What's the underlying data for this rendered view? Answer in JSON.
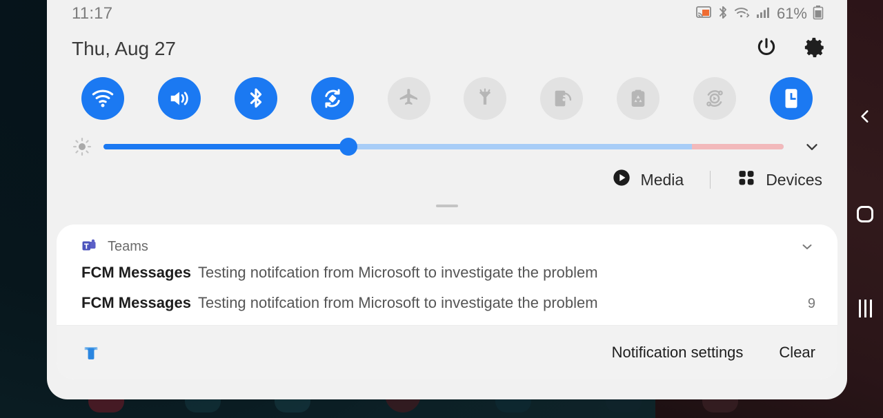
{
  "status_bar": {
    "clock": "11:17",
    "battery_percent": "61%",
    "icons": [
      "smart-view-cast-icon",
      "bluetooth-icon",
      "wifi-icon",
      "signal-icon",
      "battery-icon"
    ]
  },
  "header": {
    "date": "Thu, Aug 27",
    "power_label": "power-icon",
    "settings_label": "gear-icon"
  },
  "quick_settings": {
    "tiles": [
      {
        "name": "wifi",
        "icon": "wifi-icon",
        "active": true
      },
      {
        "name": "sound",
        "icon": "volume-icon",
        "active": true
      },
      {
        "name": "bluetooth",
        "icon": "bluetooth-icon",
        "active": true
      },
      {
        "name": "auto-rotate",
        "icon": "auto-rotate-icon",
        "active": true
      },
      {
        "name": "airplane-mode",
        "icon": "airplane-icon",
        "active": false
      },
      {
        "name": "flashlight",
        "icon": "flashlight-icon",
        "active": false
      },
      {
        "name": "mobile-data",
        "icon": "mobile-data-icon",
        "active": false
      },
      {
        "name": "power-saving",
        "icon": "power-saving-icon",
        "active": false
      },
      {
        "name": "smart-view",
        "icon": "smart-view-icon",
        "active": false
      },
      {
        "name": "blue-light-filter",
        "icon": "blue-light-filter-icon",
        "active": true
      }
    ]
  },
  "brightness": {
    "icon": "brightness-icon",
    "value_percent": 36,
    "warm_zone_percent": 13.5,
    "expand_icon": "chevron-down-icon",
    "track_color": "#a8cdf7",
    "fill_color": "#1b79f2",
    "warm_color": "#f2b9bb"
  },
  "media_devices": {
    "media_label": "Media",
    "media_icon": "play-circle-icon",
    "devices_label": "Devices",
    "devices_icon": "grid-dots-icon"
  },
  "notification": {
    "app_name": "Teams",
    "app_icon": "teams-icon",
    "collapse_icon": "chevron-down-icon",
    "rows": [
      {
        "title": "FCM Messages",
        "body": "Testing notifcation from Microsoft to investigate the problem",
        "count": ""
      },
      {
        "title": "FCM Messages",
        "body": "Testing notifcation from Microsoft to investigate the problem",
        "count": "9"
      }
    ],
    "footer": {
      "device_icon": "device-notification-icon",
      "settings_label": "Notification settings",
      "clear_label": "Clear"
    }
  },
  "nav_bar": {
    "back": "chevron-left-icon",
    "home": "home-square-icon",
    "recents": "recents-bars-icon"
  },
  "colors": {
    "accent": "#1b79f2",
    "shade_bg": "#f1f1f1",
    "card_bg": "#ffffff",
    "footer_bg": "#f2f2f2",
    "nav_bg": "#2c1418"
  }
}
